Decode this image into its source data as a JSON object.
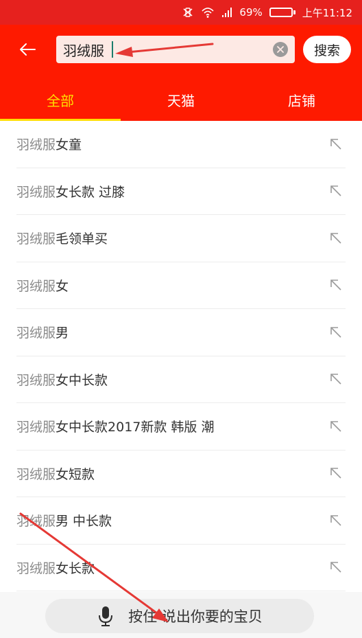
{
  "status_bar": {
    "battery": "69%",
    "time": "上午11:12",
    "battery_level": 0.69,
    "icons": [
      "vibrate-icon",
      "wifi-icon",
      "signal-icon",
      "battery-icon"
    ]
  },
  "search": {
    "value": "羽绒服",
    "button": "搜索"
  },
  "tabs": [
    {
      "label": "全部",
      "active": true
    },
    {
      "label": "天猫",
      "active": false
    },
    {
      "label": "店铺",
      "active": false
    }
  ],
  "suggestions": [
    {
      "keyword": "羽绒服",
      "rest": "女童"
    },
    {
      "keyword": "羽绒服",
      "rest": "女长款 过膝"
    },
    {
      "keyword": "羽绒服",
      "rest": "毛领单买"
    },
    {
      "keyword": "羽绒服",
      "rest": "女"
    },
    {
      "keyword": "羽绒服",
      "rest": "男"
    },
    {
      "keyword": "羽绒服",
      "rest": "女中长款"
    },
    {
      "keyword": "羽绒服",
      "rest": "女中长款2017新款 韩版 潮"
    },
    {
      "keyword": "羽绒服",
      "rest": "女短款"
    },
    {
      "keyword": "羽绒服",
      "rest": "男 中长款"
    },
    {
      "keyword": "羽绒服",
      "rest": "女长款"
    }
  ],
  "voice": {
    "label": "按住 说出你要的宝贝"
  },
  "colors": {
    "header_red": "#fe1a00",
    "status_red": "#e6211e",
    "active_tab": "#ffde00",
    "annotation_arrow": "#e53935"
  }
}
